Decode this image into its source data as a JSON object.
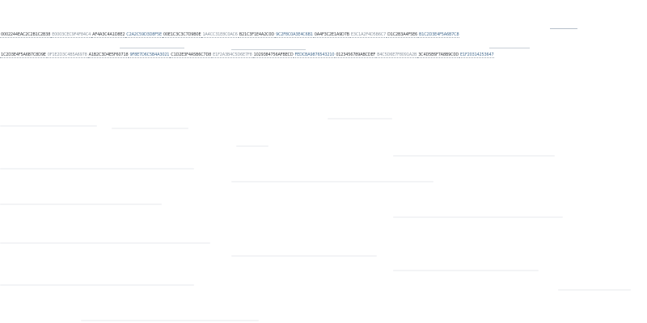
{
  "top_strip": {
    "row1": [
      "0002244EAC2C2B1C2B38",
      "E0003CEC9F4F84C4",
      "AF4A3C4A1D8E2",
      "C2A2C59D3D8F5E",
      "00E1C3C3C7D9B0E",
      "1A4CC31E8C0AC6",
      "B21C3F1E4A2C0D",
      "9C2F8C0A3E4C6B1",
      "0A4F3C2E1A9D7B",
      "E3C1A2F4D5B6C7",
      "D1C2B3A4F5E6",
      "B1C2D3E4F5A6B7C8"
    ],
    "row2": [
      "1C2D3E4F5A6B7C8D9E",
      "0F1E2D3C4B5A6978",
      "A1B2C3D4E5F60718",
      "9F8E7D6C5B4A3021",
      "C1D2E3F4A5B6C7D8",
      "E1F2A3B4C5D6E7F8",
      "1029384756AFBECD",
      "FEDCBA9876543210",
      "0123456789ABCDEF",
      "B4C5D6E7F8091A2B",
      "3C4D5E6F7A8B9C0D",
      "E1F20314253647"
    ]
  },
  "colors": {
    "background": "#ffffff",
    "text": "#3b3f45",
    "muted": "#8d96a0",
    "accent": "#4a6f92"
  }
}
